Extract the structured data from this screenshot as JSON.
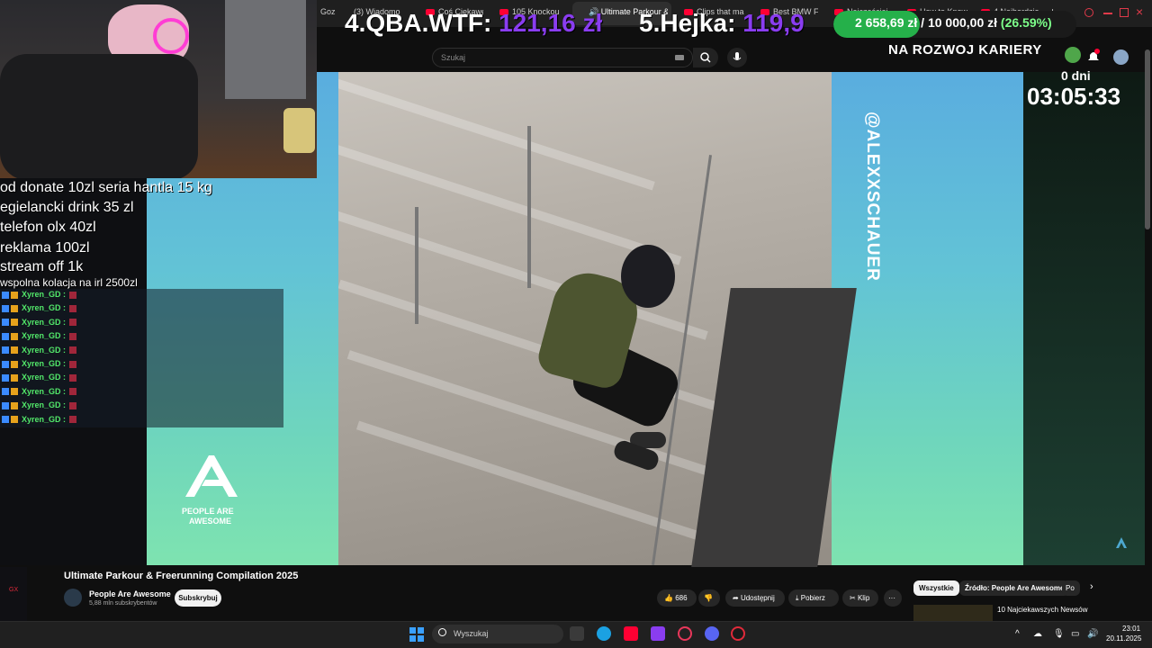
{
  "browser": {
    "tabs": [
      {
        "label": "Goz",
        "active": false
      },
      {
        "label": "(3) Wiadomo",
        "active": false
      },
      {
        "label": "Coś Ciekawe",
        "active": false
      },
      {
        "label": "105 Knockou",
        "active": false
      },
      {
        "label": "Ultimate Parkour &",
        "active": true
      },
      {
        "label": "Clips that ma",
        "active": false
      },
      {
        "label": "Best BMW F",
        "active": false
      },
      {
        "label": "Najczęściej",
        "active": false
      },
      {
        "label": "How to Know",
        "active": false
      },
      {
        "label": "4 Najbardzie",
        "active": false
      }
    ],
    "new_tab": "+"
  },
  "youtube": {
    "search_placeholder": "Szukaj",
    "video_title": "Ultimate Parkour & Freerunning Compilation 2025",
    "channel_name": "People Are Awesome",
    "channel_subs": "5,88 mln subskrybentów",
    "subscribe_label": "Subskrybuj",
    "like_count": "686",
    "share_label": "Udostępnij",
    "download_label": "Pobierz",
    "clip_label": "Klip",
    "more_label": "···",
    "chips": [
      "Wszystkie",
      "Źródło: People Are Awesome",
      "Po"
    ],
    "recommended_title": "10 Najciekawszych Newsów",
    "video_watermark": "@ALEXXSCHAUER",
    "logo_text_1": "PEOPLE ARE",
    "logo_text_2": "AWESOME"
  },
  "overlay": {
    "rank1_label": "4.QBA.WTF:",
    "rank1_value": "121,16 zł",
    "rank2_label": "5.Hejka:",
    "rank2_value": "119,9",
    "goal_current": "2 658,69 zł",
    "goal_sep": "/",
    "goal_target": "10 000,00 zł",
    "goal_percent": "(26.59%)",
    "goal_fraction": 0.2659,
    "goal_label": "NA ROZWOJ KARIERY",
    "timer_days": "0 dni",
    "timer_clock": "03:05:33",
    "price_list": [
      "od donate 10zl seria hantla 15 kg",
      "egielancki drink 35 zl",
      "telefon olx 40zl",
      "reklama 100zl",
      "stream off 1k",
      "wspolna kolacja na irl 2500zl"
    ],
    "chat_user": "Xyren_GD :",
    "chat_count": 10,
    "gx_label": "GX"
  },
  "taskbar": {
    "search_placeholder": "Wyszukaj",
    "time": "23:01",
    "date": "20.11.2025"
  },
  "colors": {
    "accent_purple": "#8a3df0",
    "goal_green": "#25b04a",
    "chat_name": "#52e86a",
    "youtube_red": "#ff0033"
  }
}
